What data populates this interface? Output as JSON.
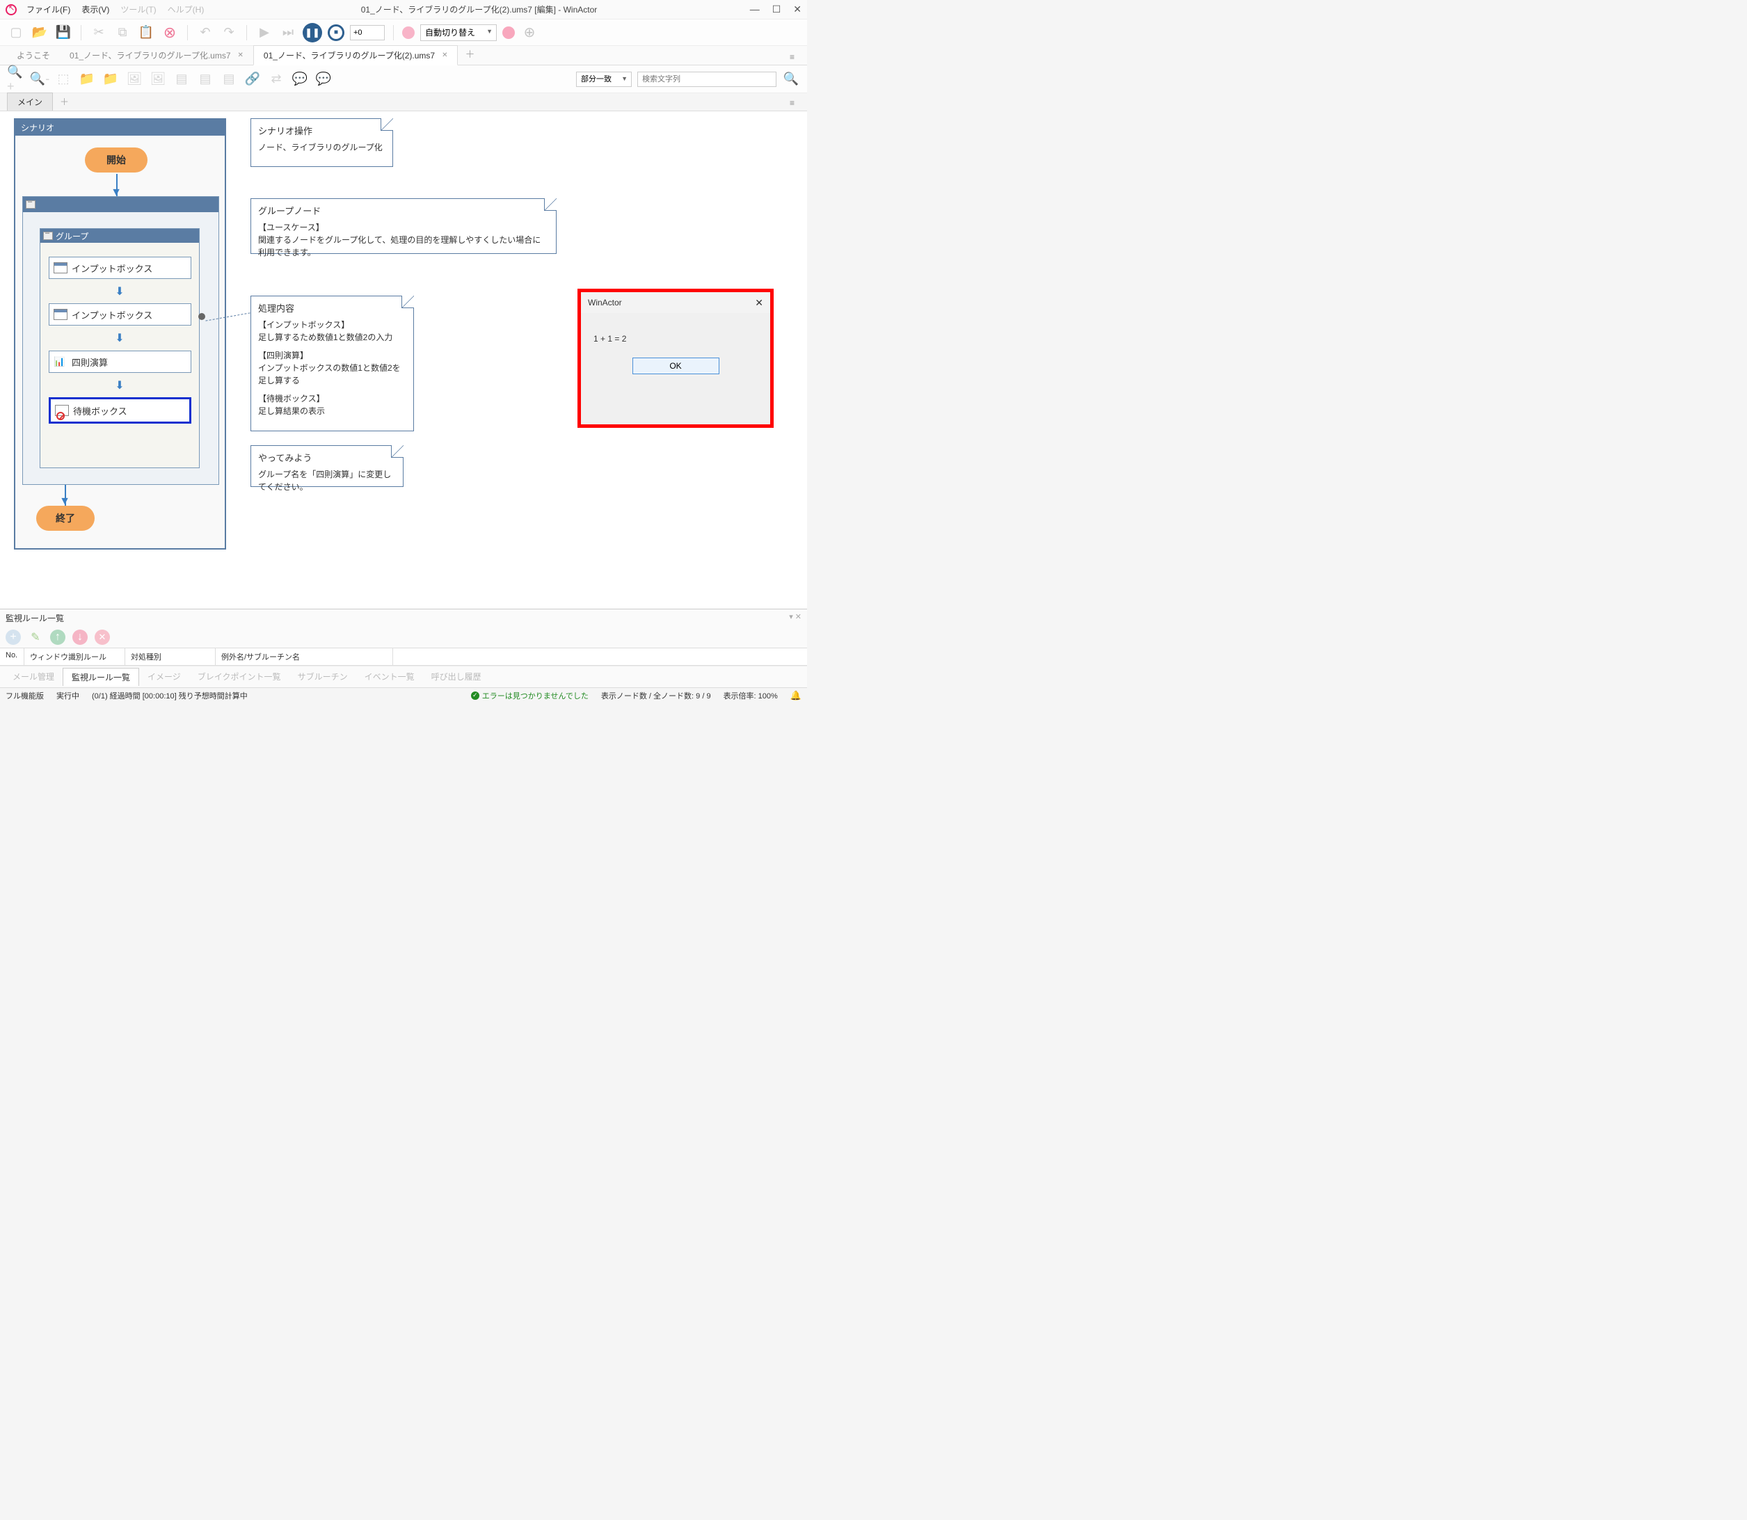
{
  "titlebar": {
    "menus": {
      "file": "ファイル(F)",
      "view": "表示(V)",
      "tool": "ツール(T)",
      "help": "ヘルプ(H)"
    },
    "title": "01_ノード、ライブラリのグループ化(2).ums7 [編集] - WinActor"
  },
  "toolbar": {
    "speed": "+0",
    "mode": "自動切り替え"
  },
  "filetabs": {
    "t1": "ようこそ",
    "t2": "01_ノード、ライブラリのグループ化.ums7",
    "t3": "01_ノード、ライブラリのグループ化(2).ums7"
  },
  "toolbar2": {
    "match": "部分一致",
    "search_placeholder": "検索文字列"
  },
  "maintabs": {
    "main": "メイン"
  },
  "scenario": {
    "header": "シナリオ",
    "start": "開始",
    "end": "終了",
    "group_label": "グループ",
    "nodes": {
      "n1": "インプットボックス",
      "n2": "インプットボックス",
      "n3": "四則演算",
      "n4": "待機ボックス"
    }
  },
  "notes": {
    "n1_title": "シナリオ操作",
    "n1_body": "ノード、ライブラリのグループ化",
    "n2_title": "グループノード",
    "n2_l1": "【ユースケース】",
    "n2_l2": "関連するノードをグループ化して、処理の目的を理解しやすくしたい場合に利用できます。",
    "n3_title": "処理内容",
    "n3_l1": "【インプットボックス】",
    "n3_l2": "足し算するため数値1と数値2の入力",
    "n3_l3": "【四則演算】",
    "n3_l4": "インプットボックスの数値1と数値2を足し算する",
    "n3_l5": "【待機ボックス】",
    "n3_l6": "足し算結果の表示",
    "n4_title": "やってみよう",
    "n4_body": "グループ名を「四則演算」に変更してください。"
  },
  "dialog": {
    "title": "WinActor",
    "body": "1 + 1 = 2",
    "ok": "OK"
  },
  "bottom": {
    "title": "監視ルール一覧",
    "cols": {
      "c1": "No.",
      "c2": "ウィンドウ識別ルール",
      "c3": "対処種別",
      "c4": "例外名/サブルーチン名"
    },
    "tabs": {
      "t1": "メール管理",
      "t2": "監視ルール一覧",
      "t3": "イメージ",
      "t4": "ブレイクポイント一覧",
      "t5": "サブルーチン",
      "t6": "イベント一覧",
      "t7": "呼び出し履歴"
    }
  },
  "status": {
    "mode": "フル機能版",
    "run": "実行中",
    "progress": "(0/1) 経過時間 [00:00:10] 残り予想時間計算中",
    "error": "エラーは見つかりませんでした",
    "nodes": "表示ノード数 / 全ノード数: 9 / 9",
    "zoom": "表示倍率: 100%"
  }
}
